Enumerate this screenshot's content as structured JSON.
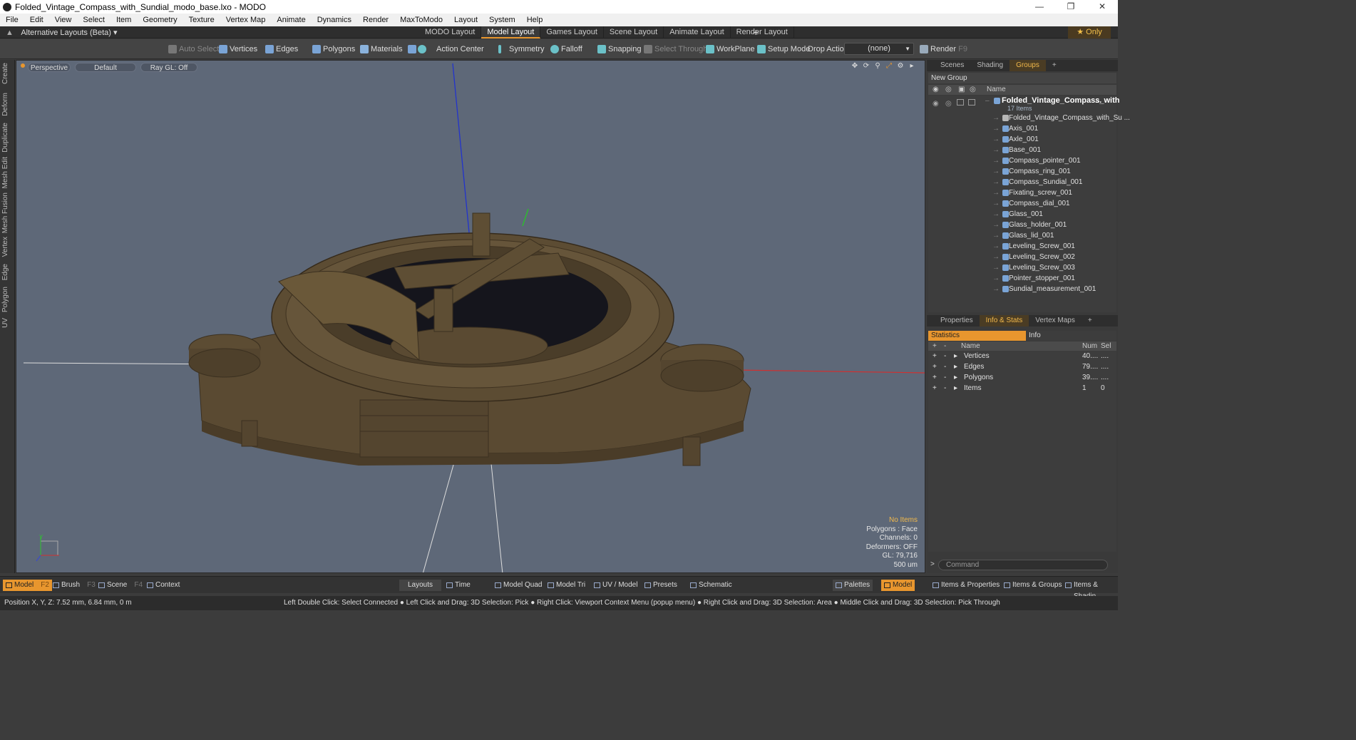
{
  "window": {
    "title": "Folded_Vintage_Compass_with_Sundial_modo_base.lxo - MODO",
    "minimize": "—",
    "maximize": "❐",
    "close": "✕"
  },
  "menu": [
    "File",
    "Edit",
    "View",
    "Select",
    "Item",
    "Geometry",
    "Texture",
    "Vertex Map",
    "Animate",
    "Dynamics",
    "Render",
    "MaxToModo",
    "Layout",
    "System",
    "Help"
  ],
  "layoutbar": {
    "alt_layouts": "Alternative Layouts (Beta)",
    "tabs": [
      "MODO Layout",
      "Model Layout",
      "Games Layout",
      "Scene Layout",
      "Animate Layout",
      "Render Layout"
    ],
    "active_tab": "Model Layout",
    "plus": "+",
    "only": "Only"
  },
  "toolbar": {
    "auto_select": "Auto Select",
    "vertices": "Vertices",
    "edges": "Edges",
    "polygons": "Polygons",
    "materials": "Materials",
    "action_center": "Action Center",
    "symmetry": "Symmetry",
    "falloff": "Falloff",
    "snapping": "Snapping",
    "select_through": "Select Through",
    "workplane": "WorkPlane",
    "setup_mode": "Setup Mode",
    "drop_action": "Drop Action",
    "drop_value": "(none)",
    "render": "Render",
    "render_key": "F9"
  },
  "lefttabs": [
    "Create",
    "Deform",
    "Duplicate",
    "Mesh Edit",
    "Mesh Fusion",
    "Vertex",
    "Edge",
    "Polygon",
    "UV"
  ],
  "viewport": {
    "view": "Perspective",
    "shading": "Default",
    "raygl": "Ray GL: Off",
    "info": {
      "no_items": "No Items",
      "polygons": "Polygons : Face",
      "channels": "Channels: 0",
      "deformers": "Deformers: OFF",
      "gl": "GL: 79,716",
      "scale": "500 um"
    },
    "axis_y": "Y"
  },
  "groups_panel": {
    "tabs": [
      "Scenes",
      "Shading",
      "Groups"
    ],
    "active_tab": "Groups",
    "new_group": "New Group",
    "name_header": "Name",
    "root": {
      "name": "Folded_Vintage_Compass_with",
      "count": "17 Items"
    },
    "items": [
      "Folded_Vintage_Compass_with_Su ...",
      "Axis_001",
      "Axle_001",
      "Base_001",
      "Compass_pointer_001",
      "Compass_ring_001",
      "Compass_Sundial_001",
      "Fixating_screw_001",
      "Compass_dial_001",
      "Glass_001",
      "Glass_holder_001",
      "Glass_lid_001",
      "Leveling_Screw_001",
      "Leveling_Screw_002",
      "Leveling_Screw_003",
      "Pointer_stopper_001",
      "Sundial_measurement_001"
    ]
  },
  "stats_panel": {
    "tabs": [
      "Properties",
      "Info & Stats",
      "Vertex Maps"
    ],
    "active_tab": "Info & Stats",
    "sub_statistics": "Statistics",
    "sub_info": "Info",
    "headers": {
      "name": "Name",
      "num": "Num",
      "sel": "Sel"
    },
    "rows": [
      {
        "name": "Vertices",
        "num": "40....",
        "sel": "...."
      },
      {
        "name": "Edges",
        "num": "79....",
        "sel": "...."
      },
      {
        "name": "Polygons",
        "num": "39....",
        "sel": "...."
      },
      {
        "name": "Items",
        "num": "1",
        "sel": "0"
      }
    ],
    "command_placeholder": "Command"
  },
  "bottombar": {
    "model": "Model",
    "model_key": "F2",
    "brush": "Brush",
    "brush_key": "F3",
    "scene": "Scene",
    "scene_key": "F4",
    "context": "Context",
    "layouts": "Layouts",
    "time": "Time",
    "model_quad": "Model Quad",
    "model_tri": "Model Tri",
    "uv_model": "UV / Model",
    "presets": "Presets",
    "schematic": "Schematic",
    "palettes": "Palettes",
    "model_right": "Model",
    "items_properties": "Items & Properties",
    "items_groups": "Items & Groups",
    "items_shading": "Items & Shadin"
  },
  "statusbar": {
    "position": "Position X, Y, Z:   7.52 mm, 6.84 mm, 0 m",
    "hints": "Left Double Click: Select Connected ● Left Click and Drag: 3D Selection: Pick ● Right Click: Viewport Context Menu (popup menu) ● Right Click and Drag: 3D Selection: Area ● Middle Click and Drag: 3D Selection: Pick Through"
  },
  "colors": {
    "accent": "#e8962e",
    "viewport_bg": "#5e6878",
    "model_color": "#5a4a32"
  }
}
